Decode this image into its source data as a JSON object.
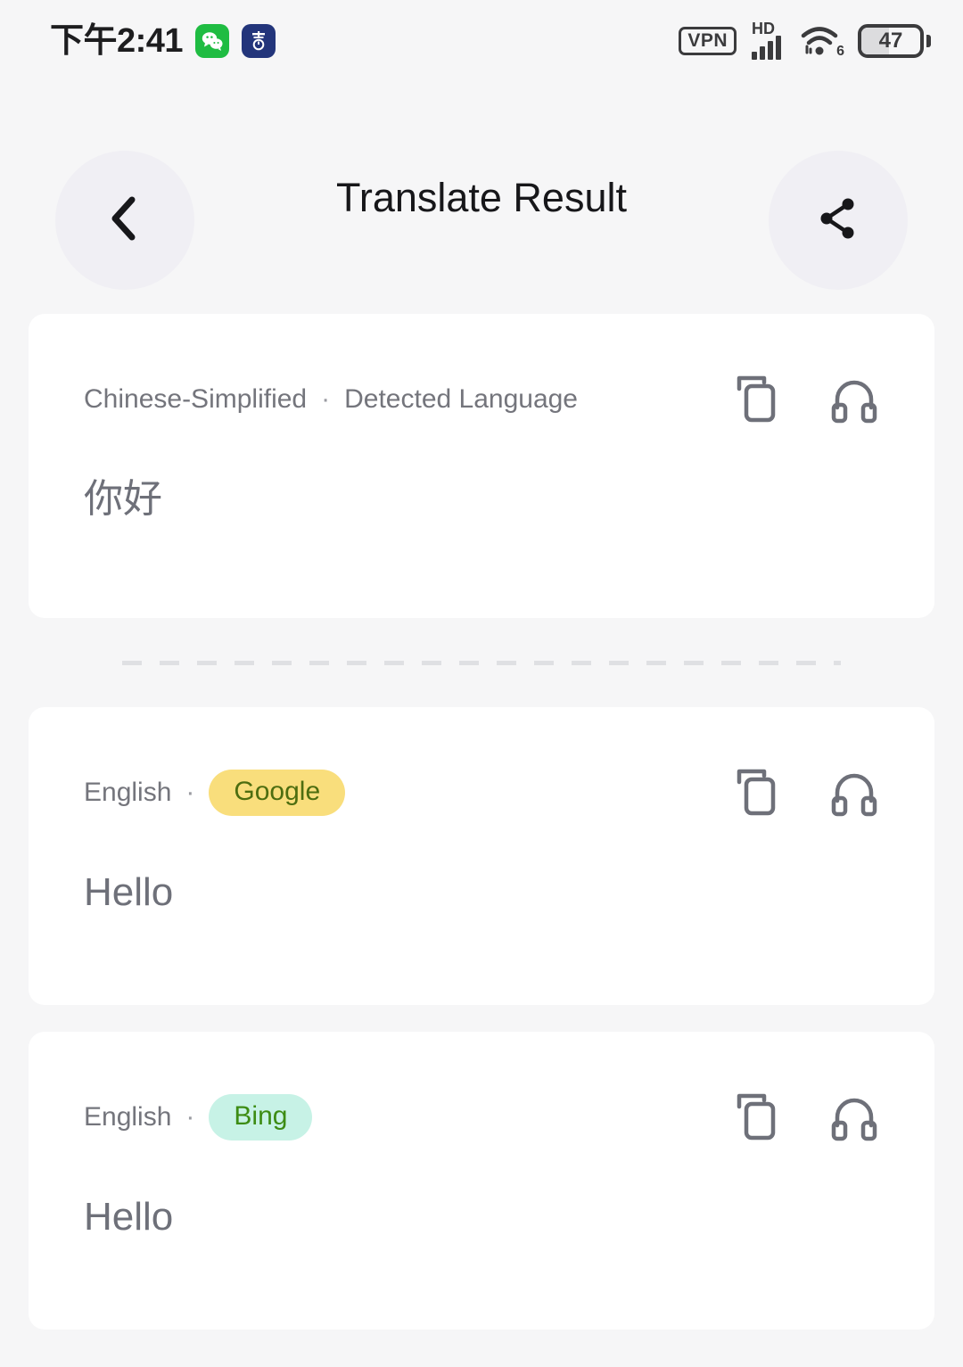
{
  "status_bar": {
    "time": "下午2:41",
    "app_icons": [
      {
        "name": "wechat-icon",
        "label": "WeChat"
      },
      {
        "name": "app-icon-blue",
        "label": "App"
      }
    ],
    "vpn_label": "VPN",
    "network_type": "HD",
    "wifi_generation": "6",
    "battery_percent": "47"
  },
  "header": {
    "title": "Translate Result",
    "back_icon": "chevron-left-icon",
    "share_icon": "share-icon"
  },
  "cards": [
    {
      "id": "source",
      "language": "Chinese-Simplified",
      "separator": "·",
      "engine": "Detected Language",
      "engine_is_pill": false,
      "text": "你好",
      "copy_icon": "copy-icon",
      "listen_icon": "headphones-icon"
    },
    {
      "id": "google",
      "language": "English",
      "separator": "·",
      "engine": "Google",
      "engine_is_pill": true,
      "text": "Hello",
      "copy_icon": "copy-icon",
      "listen_icon": "headphones-icon"
    },
    {
      "id": "bing",
      "language": "English",
      "separator": "·",
      "engine": "Bing",
      "engine_is_pill": true,
      "text": "Hello",
      "copy_icon": "copy-icon",
      "listen_icon": "headphones-icon"
    }
  ],
  "colors": {
    "page_background": "#F6F6F7",
    "card_background": "#FFFFFF",
    "google_pill_bg": "#F9DE7C",
    "google_pill_text": "#4D6D10",
    "bing_pill_bg": "#C7F2E6",
    "bing_pill_text": "#3D8C14",
    "body_text": "#6E7079",
    "meta_text": "#74757C",
    "title_text": "#17171A",
    "circle_button_bg": "#F0EFF4",
    "icon_gray": "#6E7079",
    "dash_gray": "#DFE0E3"
  }
}
